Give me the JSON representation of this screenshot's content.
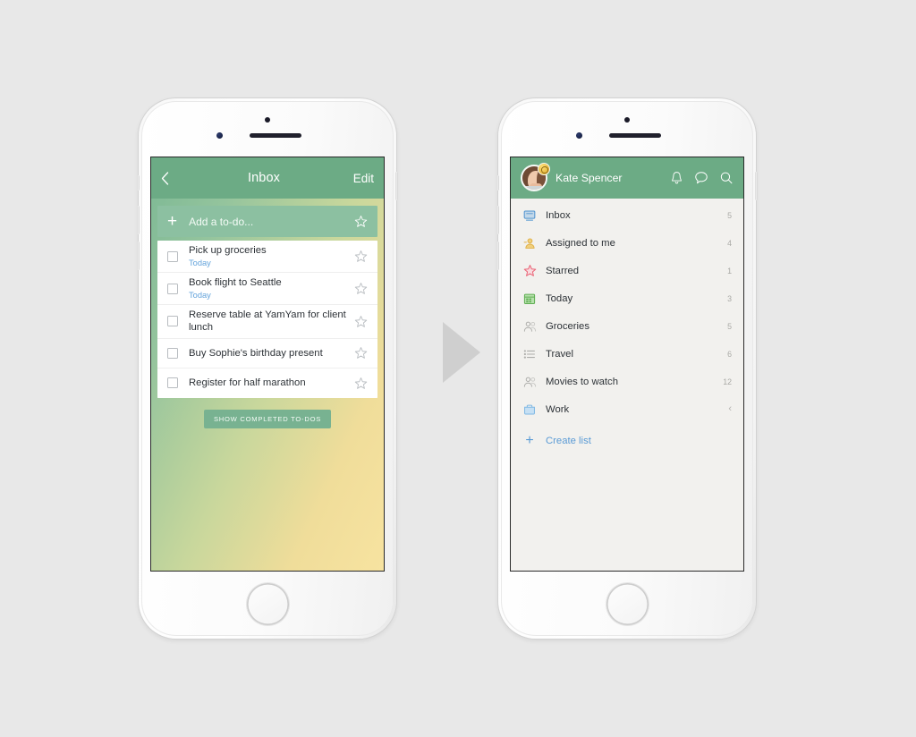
{
  "page": {
    "background_color": "#e8e8e8",
    "arrow_color": "#cfcfcf",
    "arrow_name": "flow-arrow-right"
  },
  "theme": {
    "green_header": "#6cab85",
    "accent_blue": "#5b9bd5",
    "subtitle_blue": "#63a3db",
    "right_screen_bg": "#f2f1ee",
    "gradient_from": "#7cb894",
    "gradient_to": "#f7e3a0"
  },
  "left_phone": {
    "nav": {
      "back_icon": "chevron-left-icon",
      "back_label": "‹",
      "title": "Inbox",
      "edit_label": "Edit"
    },
    "add_row": {
      "plus_label": "+",
      "placeholder": "Add a to-do...",
      "star_icon": "star-outline-icon"
    },
    "todos": [
      {
        "title": "Pick up groceries",
        "subtitle": "Today",
        "checked": false,
        "starred": false
      },
      {
        "title": "Book flight to Seattle",
        "subtitle": "Today",
        "checked": false,
        "starred": false
      },
      {
        "title": "Reserve table at YamYam for client lunch",
        "subtitle": "",
        "checked": false,
        "starred": false
      },
      {
        "title": "Buy Sophie's birthday present",
        "subtitle": "",
        "checked": false,
        "starred": false
      },
      {
        "title": "Register for half marathon",
        "subtitle": "",
        "checked": false,
        "starred": false
      }
    ],
    "show_completed_label": "SHOW COMPLETED TO-DOS"
  },
  "right_phone": {
    "nav": {
      "user_name": "Kate Spencer",
      "avatar_icon": "user-avatar-photo",
      "badge_icon": "crown-badge-icon",
      "icons": [
        {
          "name": "bell-icon",
          "label": "Notifications"
        },
        {
          "name": "chat-bubble-icon",
          "label": "Messages"
        },
        {
          "name": "search-icon",
          "label": "Search"
        }
      ]
    },
    "lists": [
      {
        "label": "Inbox",
        "count": "5",
        "icon": "inbox-monitor-icon",
        "color": "#6da9df",
        "chevron": ""
      },
      {
        "label": "Assigned to me",
        "count": "4",
        "icon": "assigned-person-icon",
        "color": "#e8bd55",
        "chevron": ""
      },
      {
        "label": "Starred",
        "count": "1",
        "icon": "star-icon",
        "color": "#ec6a7a",
        "chevron": ""
      },
      {
        "label": "Today",
        "count": "3",
        "icon": "calendar-icon",
        "color": "#76bf6b",
        "chevron": ""
      },
      {
        "label": "Groceries",
        "count": "5",
        "icon": "people-icon",
        "color": "#b0b0ac",
        "chevron": ""
      },
      {
        "label": "Travel",
        "count": "6",
        "icon": "list-icon",
        "color": "#b0b0ac",
        "chevron": ""
      },
      {
        "label": "Movies to watch",
        "count": "12",
        "icon": "people-icon",
        "color": "#b0b0ac",
        "chevron": ""
      },
      {
        "label": "Work",
        "count": "",
        "icon": "folder-icon",
        "color": "#8dc0e8",
        "chevron": "‹"
      }
    ],
    "create_list": {
      "plus_label": "+",
      "label": "Create list",
      "icon": "plus-icon"
    }
  }
}
